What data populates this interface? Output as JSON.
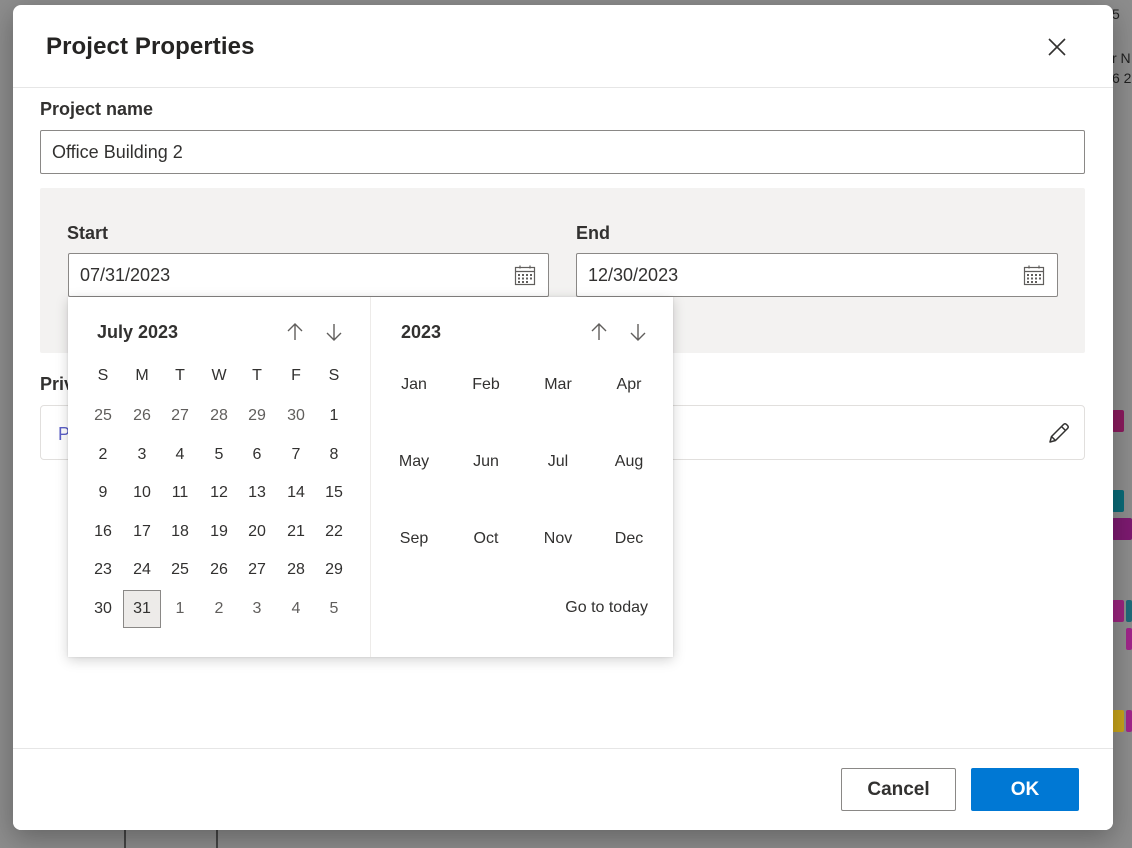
{
  "background": {
    "right_texts": [
      "5",
      "r N",
      "6 2"
    ],
    "chip_colors": [
      "#8b1b5e",
      "#0a6b78",
      "#7d1a70",
      "#9c247f",
      "#1f6b7a",
      "#c9a51a",
      "#a0268a"
    ]
  },
  "dialog": {
    "title": "Project Properties",
    "close_icon": "close-icon"
  },
  "project_name": {
    "label": "Project name",
    "value": "Office Building 2"
  },
  "dates": {
    "start_label": "Start",
    "start_value": "07/31/2023",
    "end_label": "End",
    "end_value": "12/30/2023",
    "icon": "calendar-icon"
  },
  "privacy": {
    "label_visible": "Priv",
    "placeholder_visible": "P",
    "edit_icon": "pencil-icon"
  },
  "calendar": {
    "month_title": "July 2023",
    "weekdays": [
      "S",
      "M",
      "T",
      "W",
      "T",
      "F",
      "S"
    ],
    "weeks": [
      [
        "25",
        "26",
        "27",
        "28",
        "29",
        "30",
        "1"
      ],
      [
        "2",
        "3",
        "4",
        "5",
        "6",
        "7",
        "8"
      ],
      [
        "9",
        "10",
        "11",
        "12",
        "13",
        "14",
        "15"
      ],
      [
        "16",
        "17",
        "18",
        "19",
        "20",
        "21",
        "22"
      ],
      [
        "23",
        "24",
        "25",
        "26",
        "27",
        "28",
        "29"
      ],
      [
        "30",
        "31",
        "1",
        "2",
        "3",
        "4",
        "5"
      ]
    ],
    "selected_day": "31",
    "year_title": "2023",
    "months": [
      "Jan",
      "Feb",
      "Mar",
      "Apr",
      "May",
      "Jun",
      "Jul",
      "Aug",
      "Sep",
      "Oct",
      "Nov",
      "Dec"
    ],
    "go_to_today": "Go to today"
  },
  "footer": {
    "cancel_label": "Cancel",
    "ok_label": "OK"
  },
  "colors": {
    "primary": "#0078d4",
    "panel": "#f3f2f1"
  }
}
